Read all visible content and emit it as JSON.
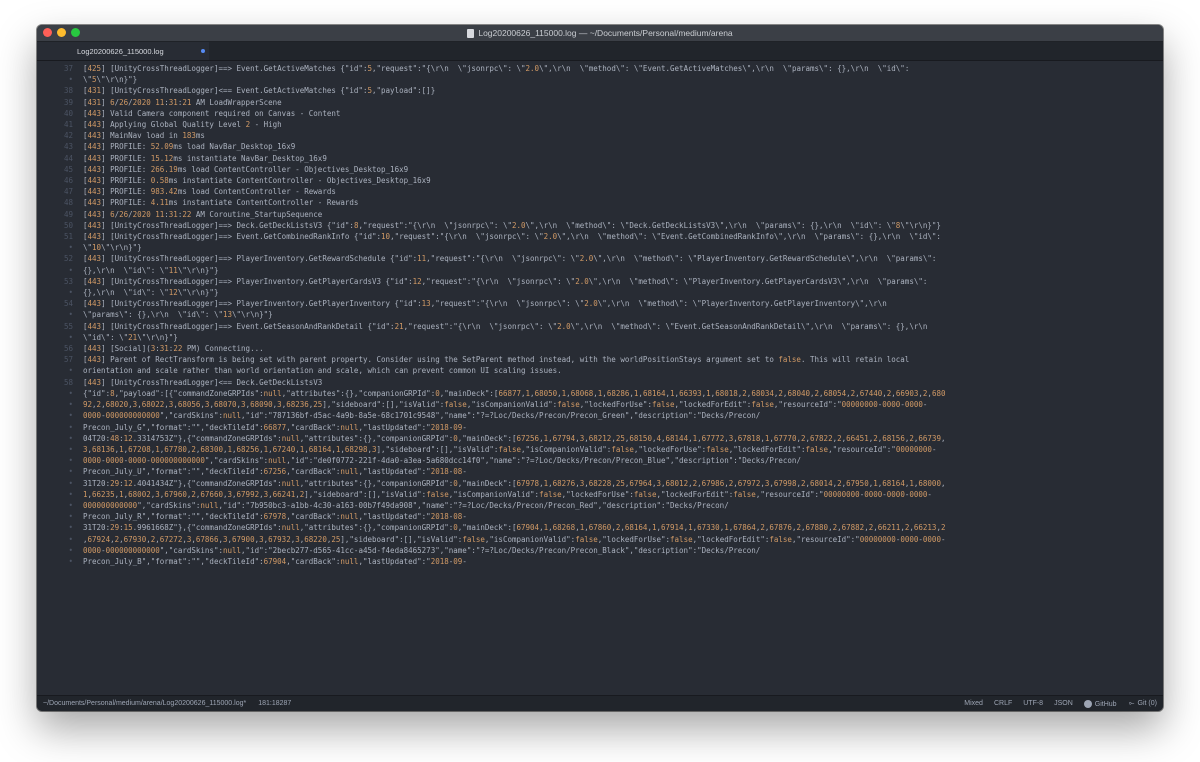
{
  "window": {
    "title": "Log20200626_115000.log — ~/Documents/Personal/medium/arena"
  },
  "tabs": [
    {
      "label": "Log20200626_115000.log"
    }
  ],
  "editor": {
    "lines": [
      {
        "num": "37",
        "text": "[425] [UnityCrossThreadLogger]==> Event.GetActiveMatches {\"id\":5,\"request\":\"{\\r\\n  \\\"jsonrpc\\\": \\\"2.0\\\",\\r\\n  \\\"method\\\": \\\"Event.GetActiveMatches\\\",\\r\\n  \\\"params\\\": {},\\r\\n  \\\"id\\\":"
      },
      {
        "num": "•",
        "text": "\\\"5\\\"\\r\\n}\"}"
      },
      {
        "num": "38",
        "text": "[431] [UnityCrossThreadLogger]<== Event.GetActiveMatches {\"id\":5,\"payload\":[]}"
      },
      {
        "num": "39",
        "text": "[431] 6/26/2020 11:31:21 AM LoadWrapperScene"
      },
      {
        "num": "40",
        "text": "[443] Valid Camera component required on Canvas - Content"
      },
      {
        "num": "41",
        "text": "[443] Applying Global Quality Level 2 - High"
      },
      {
        "num": "42",
        "text": "[443] MainNav load in 183ms"
      },
      {
        "num": "43",
        "text": "[443] PROFILE: 52.09ms load NavBar_Desktop_16x9"
      },
      {
        "num": "44",
        "text": "[443] PROFILE: 15.12ms instantiate NavBar_Desktop_16x9"
      },
      {
        "num": "45",
        "text": "[443] PROFILE: 266.19ms load ContentController - Objectives_Desktop_16x9"
      },
      {
        "num": "46",
        "text": "[443] PROFILE: 0.58ms instantiate ContentController - Objectives_Desktop_16x9"
      },
      {
        "num": "47",
        "text": "[443] PROFILE: 983.42ms load ContentController - Rewards"
      },
      {
        "num": "48",
        "text": "[443] PROFILE: 4.11ms instantiate ContentController - Rewards"
      },
      {
        "num": "49",
        "text": "[443] 6/26/2020 11:31:22 AM Coroutine_StartupSequence"
      },
      {
        "num": "50",
        "text": "[443] [UnityCrossThreadLogger]==> Deck.GetDeckListsV3 {\"id\":8,\"request\":\"{\\r\\n  \\\"jsonrpc\\\": \\\"2.0\\\",\\r\\n  \\\"method\\\": \\\"Deck.GetDeckListsV3\\\",\\r\\n  \\\"params\\\": {},\\r\\n  \\\"id\\\": \\\"8\\\"\\r\\n}\"}"
      },
      {
        "num": "51",
        "text": "[443] [UnityCrossThreadLogger]==> Event.GetCombinedRankInfo {\"id\":10,\"request\":\"{\\r\\n  \\\"jsonrpc\\\": \\\"2.0\\\",\\r\\n  \\\"method\\\": \\\"Event.GetCombinedRankInfo\\\",\\r\\n  \\\"params\\\": {},\\r\\n  \\\"id\\\":"
      },
      {
        "num": "•",
        "text": "\\\"10\\\"\\r\\n}\"}"
      },
      {
        "num": "52",
        "text": "[443] [UnityCrossThreadLogger]==> PlayerInventory.GetRewardSchedule {\"id\":11,\"request\":\"{\\r\\n  \\\"jsonrpc\\\": \\\"2.0\\\",\\r\\n  \\\"method\\\": \\\"PlayerInventory.GetRewardSchedule\\\",\\r\\n  \\\"params\\\":"
      },
      {
        "num": "•",
        "text": "{},\\r\\n  \\\"id\\\": \\\"11\\\"\\r\\n}\"}"
      },
      {
        "num": "53",
        "text": "[443] [UnityCrossThreadLogger]==> PlayerInventory.GetPlayerCardsV3 {\"id\":12,\"request\":\"{\\r\\n  \\\"jsonrpc\\\": \\\"2.0\\\",\\r\\n  \\\"method\\\": \\\"PlayerInventory.GetPlayerCardsV3\\\",\\r\\n  \\\"params\\\":"
      },
      {
        "num": "•",
        "text": "{},\\r\\n  \\\"id\\\": \\\"12\\\"\\r\\n}\"}"
      },
      {
        "num": "54",
        "text": "[443] [UnityCrossThreadLogger]==> PlayerInventory.GetPlayerInventory {\"id\":13,\"request\":\"{\\r\\n  \\\"jsonrpc\\\": \\\"2.0\\\",\\r\\n  \\\"method\\\": \\\"PlayerInventory.GetPlayerInventory\\\",\\r\\n"
      },
      {
        "num": "•",
        "text": "\\\"params\\\": {},\\r\\n  \\\"id\\\": \\\"13\\\"\\r\\n}\"}"
      },
      {
        "num": "55",
        "text": "[443] [UnityCrossThreadLogger]==> Event.GetSeasonAndRankDetail {\"id\":21,\"request\":\"{\\r\\n  \\\"jsonrpc\\\": \\\"2.0\\\",\\r\\n  \\\"method\\\": \\\"Event.GetSeasonAndRankDetail\\\",\\r\\n  \\\"params\\\": {},\\r\\n"
      },
      {
        "num": "•",
        "text": "\\\"id\\\": \\\"21\\\"\\r\\n}\"}"
      },
      {
        "num": "56",
        "text": "[443] [Social](3:31:22 PM) Connecting..."
      },
      {
        "num": "57",
        "text": "[443] Parent of RectTransform is being set with parent property. Consider using the SetParent method instead, with the worldPositionStays argument set to false. This will retain local"
      },
      {
        "num": "•",
        "text": "orientation and scale rather than world orientation and scale, which can prevent common UI scaling issues."
      },
      {
        "num": "58",
        "text": "[443] [UnityCrossThreadLogger]<== Deck.GetDeckListsV3"
      },
      {
        "num": "•",
        "text": "{\"id\":8,\"payload\":[{\"commandZoneGRPIds\":null,\"attributes\":{},\"companionGRPId\":0,\"mainDeck\":[66877,1,68050,1,68068,1,68286,1,68164,1,66393,1,68018,2,68034,2,68040,2,68054,2,67440,2,66903,2,680"
      },
      {
        "num": "•",
        "text": "92,2,68020,3,68022,3,68056,3,68070,3,68090,3,68236,25],\"sideboard\":[],\"isValid\":false,\"isCompanionValid\":false,\"lockedForUse\":false,\"lockedForEdit\":false,\"resourceId\":\"00000000-0000-0000-"
      },
      {
        "num": "•",
        "text": "0000-000000000000\",\"cardSkins\":null,\"id\":\"787136bf-d5ac-4a9b-8a5e-68c1701c9548\",\"name\":\"?=?Loc/Decks/Precon/Precon_Green\",\"description\":\"Decks/Precon/"
      },
      {
        "num": "•",
        "text": "Precon_July_G\",\"format\":\"\",\"deckTileId\":66877,\"cardBack\":null,\"lastUpdated\":\"2018-09-"
      },
      {
        "num": "•",
        "text": "04T20:48:12.3314753Z\"},{\"commandZoneGRPIds\":null,\"attributes\":{},\"companionGRPId\":0,\"mainDeck\":[67256,1,67794,3,68212,25,68150,4,68144,1,67772,3,67818,1,67770,2,67822,2,66451,2,68156,2,66739,"
      },
      {
        "num": "•",
        "text": "3,68136,1,67208,1,67780,2,68300,1,68256,1,67240,1,68164,1,68298,3],\"sideboard\":[],\"isValid\":false,\"isCompanionValid\":false,\"lockedForUse\":false,\"lockedForEdit\":false,\"resourceId\":\"00000000-"
      },
      {
        "num": "•",
        "text": "0000-0000-0000-000000000000\",\"cardSkins\":null,\"id\":\"de0f0772-221f-4da0-a3ea-5a680dcc14f0\",\"name\":\"?=?Loc/Decks/Precon/Precon_Blue\",\"description\":\"Decks/Precon/"
      },
      {
        "num": "•",
        "text": "Precon_July_U\",\"format\":\"\",\"deckTileId\":67256,\"cardBack\":null,\"lastUpdated\":\"2018-08-"
      },
      {
        "num": "•",
        "text": "31T20:29:12.4041434Z\"},{\"commandZoneGRPIds\":null,\"attributes\":{},\"companionGRPId\":0,\"mainDeck\":[67978,1,68276,3,68228,25,67964,3,68012,2,67986,2,67972,3,67998,2,68014,2,67950,1,68164,1,68000,"
      },
      {
        "num": "•",
        "text": "1,66235,1,68002,3,67960,2,67660,3,67992,3,66241,2],\"sideboard\":[],\"isValid\":false,\"isCompanionValid\":false,\"lockedForUse\":false,\"lockedForEdit\":false,\"resourceId\":\"00000000-0000-0000-0000-"
      },
      {
        "num": "•",
        "text": "000000000000\",\"cardSkins\":null,\"id\":\"7b950bc3-a1bb-4c30-a163-00b7f49da908\",\"name\":\"?=?Loc/Decks/Precon/Precon_Red\",\"description\":\"Decks/Precon/"
      },
      {
        "num": "•",
        "text": "Precon_July_R\",\"format\":\"\",\"deckTileId\":67978,\"cardBack\":null,\"lastUpdated\":\"2018-08-"
      },
      {
        "num": "•",
        "text": "31T20:29:15.9961668Z\"},{\"commandZoneGRPIds\":null,\"attributes\":{},\"companionGRPId\":0,\"mainDeck\":[67904,1,68268,1,67860,2,68164,1,67914,1,67330,1,67864,2,67876,2,67880,2,67882,2,66211,2,66213,2"
      },
      {
        "num": "•",
        "text": ",67924,2,67930,2,67272,3,67866,3,67900,3,67932,3,68220,25],\"sideboard\":[],\"isValid\":false,\"isCompanionValid\":false,\"lockedForUse\":false,\"lockedForEdit\":false,\"resourceId\":\"00000000-0000-0000-"
      },
      {
        "num": "•",
        "text": "0000-000000000000\",\"cardSkins\":null,\"id\":\"2becb277-d565-41cc-a45d-f4eda8465273\",\"name\":\"?=?Loc/Decks/Precon/Precon_Black\",\"description\":\"Decks/Precon/"
      },
      {
        "num": "•",
        "text": "Precon_July_B\",\"format\":\"\",\"deckTileId\":67904,\"cardBack\":null,\"lastUpdated\":\"2018-09-"
      }
    ]
  },
  "statusbar": {
    "path": "~/Documents/Personal/medium/arena/Log20200626_115000.log*",
    "cursor": "181:18287",
    "indent": "Mixed",
    "line_ending": "CRLF",
    "encoding": "UTF-8",
    "grammar": "JSON",
    "github": "GitHub",
    "git": "Git (0)"
  },
  "colors": {
    "background": "#282c34",
    "number": "#d19a66",
    "keyword": "#e5c07b",
    "string": "#56b6c2",
    "text": "#abb2bf"
  }
}
